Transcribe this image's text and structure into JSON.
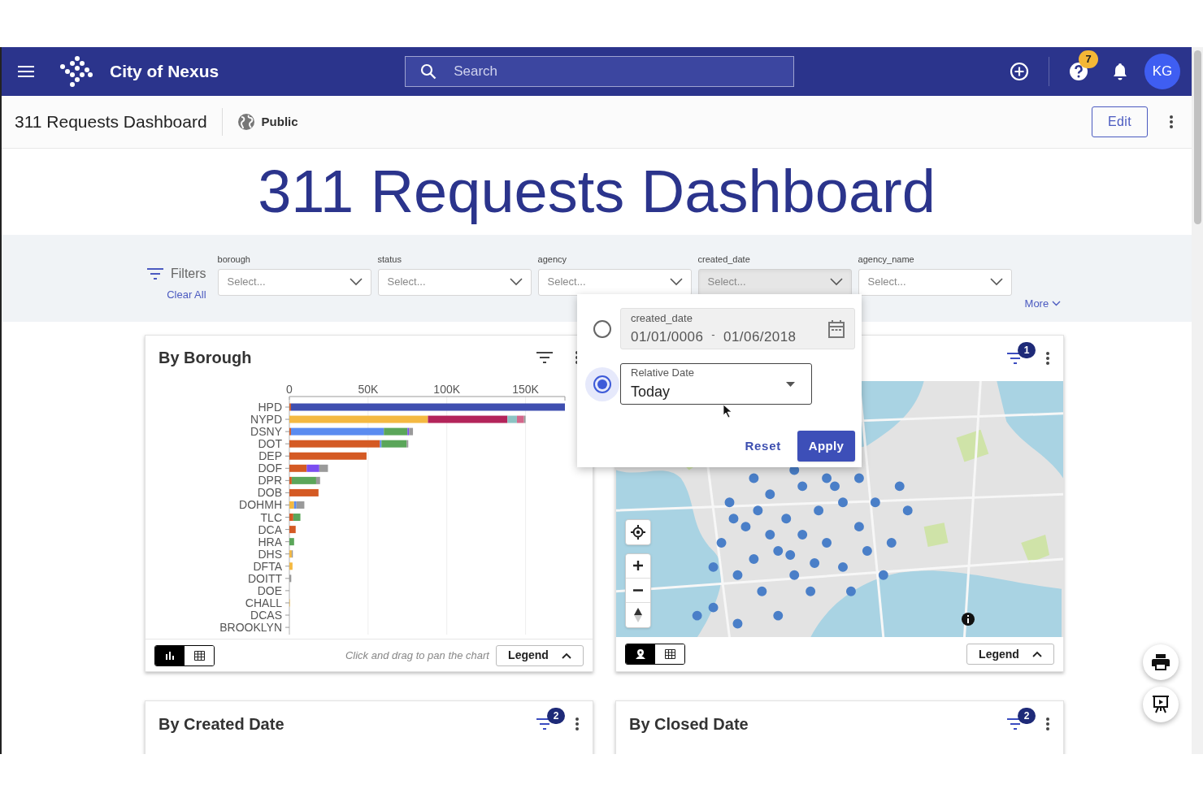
{
  "app_bar": {
    "brand": "City of Nexus",
    "search_placeholder": "Search",
    "help_badge": "7",
    "avatar": "KG"
  },
  "page_header": {
    "title": "311 Requests Dashboard",
    "visibility": "Public",
    "edit_button": "Edit"
  },
  "dashboard_title": "311 Requests Dashboard",
  "filters": {
    "label": "Filters",
    "clear_all": "Clear All",
    "more": "More",
    "fields": [
      {
        "label": "borough",
        "placeholder": "Select...",
        "active": false
      },
      {
        "label": "status",
        "placeholder": "Select...",
        "active": false
      },
      {
        "label": "agency",
        "placeholder": "Select...",
        "active": false
      },
      {
        "label": "created_date",
        "placeholder": "Select...",
        "active": true
      },
      {
        "label": "agency_name",
        "placeholder": "Select...",
        "active": false
      }
    ]
  },
  "date_popup": {
    "options": [
      {
        "kind": "range",
        "label": "created_date",
        "start": "01/01/0006",
        "separator": "-",
        "end": "01/06/2018",
        "selected": false
      },
      {
        "kind": "relative",
        "label": "Relative Date",
        "value": "Today",
        "selected": true
      }
    ],
    "reset_button": "Reset",
    "apply_button": "Apply"
  },
  "cards": [
    {
      "kind": "chart",
      "title": "By Borough",
      "view_toggle": [
        {
          "kind": "chart",
          "selected": true
        },
        {
          "kind": "table",
          "selected": false
        }
      ],
      "hint": "Click and drag to pan the chart",
      "legend_button": "Legend",
      "chart_data": {
        "type": "bar",
        "orientation": "horizontal",
        "stacked": true,
        "grid": true,
        "categories": [
          "HPD",
          "NYPD",
          "DSNY",
          "DOT",
          "DEP",
          "DOF",
          "DPR",
          "DOB",
          "DOHMH",
          "TLC",
          "DCA",
          "HRA",
          "DHS",
          "DFTA",
          "DOITT",
          "DOE",
          "CHALL",
          "DCAS",
          "BROOKLYN"
        ],
        "xlim": [
          0,
          175000
        ],
        "xticks": [
          {
            "value": 0,
            "label": "0"
          },
          {
            "value": 50000,
            "label": "50K"
          },
          {
            "value": 100000,
            "label": "100K"
          },
          {
            "value": 150000,
            "label": "150K"
          }
        ],
        "series": [
          {
            "color": "#d45a24",
            "values": [
              1000,
              0,
              1000,
              57500,
              49000,
              11000,
              1500,
              18500,
              0,
              2500,
              4000,
              0,
              0,
              0,
              0,
              0,
              0,
              0,
              0
            ]
          },
          {
            "color": "#f4b942",
            "values": [
              0,
              88000,
              0,
              0,
              0,
              0,
              0,
              0,
              3000,
              0,
              0,
              0,
              1500,
              2000,
              0,
              0,
              300,
              0,
              0
            ]
          },
          {
            "color": "#3f4fb0",
            "values": [
              174000,
              0,
              0,
              0,
              0,
              0,
              0,
              0,
              0,
              0,
              0,
              0,
              0,
              0,
              0,
              0,
              0,
              0,
              0
            ]
          },
          {
            "color": "#b3245a",
            "values": [
              0,
              50500,
              0,
              0,
              0,
              0,
              0,
              0,
              0,
              0,
              0,
              0,
              0,
              0,
              0,
              0,
              0,
              0,
              0
            ]
          },
          {
            "color": "#8cc3c3",
            "values": [
              0,
              6000,
              0,
              0,
              0,
              0,
              0,
              0,
              0,
              0,
              0,
              0,
              0,
              0,
              0,
              0,
              0,
              0,
              0
            ]
          },
          {
            "color": "#d3668a",
            "values": [
              0,
              4500,
              0,
              0,
              0,
              0,
              0,
              0,
              0,
              0,
              0,
              0,
              0,
              0,
              0,
              0,
              0,
              0,
              0
            ]
          },
          {
            "color": "#5b8cf0",
            "values": [
              0,
              0,
              59000,
              1000,
              0,
              0,
              0,
              0,
              1500,
              0,
              0,
              0,
              0,
              0,
              0,
              0,
              0,
              0,
              0
            ]
          },
          {
            "color": "#5ba65a",
            "values": [
              0,
              0,
              15000,
              16000,
              0,
              0,
              15500,
              0,
              0,
              4500,
              0,
              3000,
              0,
              0,
              0,
              0,
              0,
              0,
              0
            ]
          },
          {
            "color": "#7b4ef0",
            "values": [
              0,
              0,
              1000,
              0,
              0,
              8000,
              0,
              0,
              0,
              0,
              0,
              0,
              0,
              0,
              0,
              0,
              0,
              0,
              0
            ]
          },
          {
            "color": "#9a9a9a",
            "values": [
              0,
              1000,
              2500,
              1000,
              0,
              5500,
              2500,
              0,
              5000,
              0,
              0,
              0,
              700,
              0,
              1200,
              null,
              0,
              null,
              0
            ]
          }
        ]
      }
    },
    {
      "kind": "map",
      "filter_badge": "1",
      "view_toggle": [
        {
          "kind": "map",
          "selected": true
        },
        {
          "kind": "table",
          "selected": false
        }
      ],
      "legend_button": "Legend"
    },
    {
      "kind": "chart",
      "title": "By Created Date",
      "filter_badge": "2"
    },
    {
      "kind": "chart",
      "title": "By Closed Date",
      "filter_badge": "2"
    }
  ]
}
